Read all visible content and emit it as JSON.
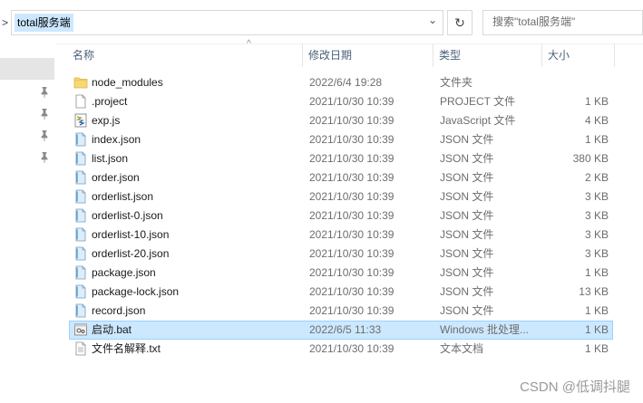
{
  "address": {
    "path": "total服务端",
    "nav_chevron": ">",
    "dropdown": "⌄",
    "refresh": "↻"
  },
  "search": {
    "placeholder": "搜索\"total服务端\""
  },
  "columns": [
    {
      "key": "name",
      "label": "名称"
    },
    {
      "key": "date",
      "label": "修改日期"
    },
    {
      "key": "type",
      "label": "类型"
    },
    {
      "key": "size",
      "label": "大小"
    }
  ],
  "sort_indicator": "^",
  "files": [
    {
      "name": "node_modules",
      "date": "2022/6/4 19:28",
      "type": "文件夹",
      "size": "",
      "icon": "folder-icon"
    },
    {
      "name": ".project",
      "date": "2021/10/30 10:39",
      "type": "PROJECT 文件",
      "size": "1 KB",
      "icon": "file-icon"
    },
    {
      "name": "exp.js",
      "date": "2021/10/30 10:39",
      "type": "JavaScript 文件",
      "size": "4 KB",
      "icon": "js-file-icon"
    },
    {
      "name": "index.json",
      "date": "2021/10/30 10:39",
      "type": "JSON 文件",
      "size": "1 KB",
      "icon": "json-file-icon"
    },
    {
      "name": "list.json",
      "date": "2021/10/30 10:39",
      "type": "JSON 文件",
      "size": "380 KB",
      "icon": "json-file-icon"
    },
    {
      "name": "order.json",
      "date": "2021/10/30 10:39",
      "type": "JSON 文件",
      "size": "2 KB",
      "icon": "json-file-icon"
    },
    {
      "name": "orderlist.json",
      "date": "2021/10/30 10:39",
      "type": "JSON 文件",
      "size": "3 KB",
      "icon": "json-file-icon"
    },
    {
      "name": "orderlist-0.json",
      "date": "2021/10/30 10:39",
      "type": "JSON 文件",
      "size": "3 KB",
      "icon": "json-file-icon"
    },
    {
      "name": "orderlist-10.json",
      "date": "2021/10/30 10:39",
      "type": "JSON 文件",
      "size": "3 KB",
      "icon": "json-file-icon"
    },
    {
      "name": "orderlist-20.json",
      "date": "2021/10/30 10:39",
      "type": "JSON 文件",
      "size": "3 KB",
      "icon": "json-file-icon"
    },
    {
      "name": "package.json",
      "date": "2021/10/30 10:39",
      "type": "JSON 文件",
      "size": "1 KB",
      "icon": "json-file-icon"
    },
    {
      "name": "package-lock.json",
      "date": "2021/10/30 10:39",
      "type": "JSON 文件",
      "size": "13 KB",
      "icon": "json-file-icon"
    },
    {
      "name": "record.json",
      "date": "2021/10/30 10:39",
      "type": "JSON 文件",
      "size": "1 KB",
      "icon": "json-file-icon"
    },
    {
      "name": "启动.bat",
      "date": "2022/6/5 11:33",
      "type": "Windows 批处理...",
      "size": "1 KB",
      "icon": "bat-file-icon",
      "selected": true
    },
    {
      "name": "文件名解释.txt",
      "date": "2021/10/30 10:39",
      "type": "文本文档",
      "size": "1 KB",
      "icon": "txt-file-icon"
    }
  ],
  "watermark": "CSDN @低调抖腿",
  "colors": {
    "selection": "#cce8ff",
    "selection_border": "#99d1ff",
    "header_text": "#4c607a",
    "folder": "#f8d775"
  }
}
